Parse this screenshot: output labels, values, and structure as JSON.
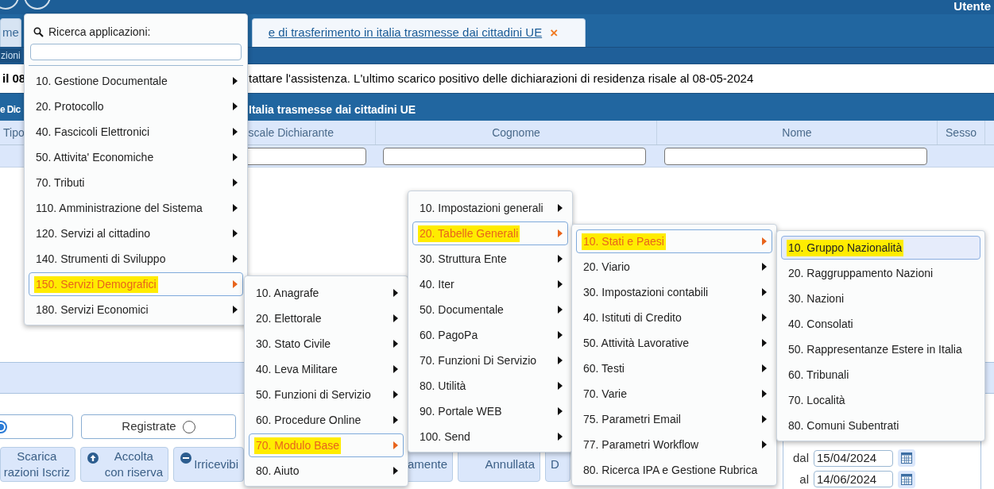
{
  "header": {
    "user": "Utente"
  },
  "tabs": [
    {
      "label": "me",
      "selected": false
    },
    {
      "label": "e di trasferimento in italia trasmesse dai cittadini UE",
      "selected": true,
      "close": "×"
    }
  ],
  "breadcrumb": "zioni",
  "message": {
    "part_1": "il 08",
    "part_2": "tattare l'assistenza. L'ultimo scarico positivo delle dichiarazioni di residenza risale al 08-05-2024"
  },
  "panel": {
    "title_part_1": "e Dic",
    "title_part_2": "Italia trasmesse dai cittadini UE"
  },
  "table": {
    "columns": [
      "Tipo",
      "scale Dichiarante",
      "Cognome",
      "Nome",
      "Sesso"
    ]
  },
  "radios": [
    {
      "selected": true
    },
    {
      "label": "Registrate",
      "selected": false
    }
  ],
  "actions": [
    {
      "label": "Scarica\nrazioni Iscriz",
      "kind": "plain"
    },
    {
      "label": "Accolta\ncon riserva",
      "kind": "accept"
    },
    {
      "label": "Irricevibi",
      "kind": "reject"
    },
    {
      "label": "amente",
      "kind": "plain"
    },
    {
      "label": "Annullata",
      "kind": "plain"
    },
    {
      "label": "D",
      "kind": "plain"
    }
  ],
  "dates": [
    {
      "label": "dal",
      "value": "15/04/2024"
    },
    {
      "label": "al",
      "value": "14/06/2024"
    }
  ],
  "search": {
    "label": "Ricerca applicazioni:"
  },
  "menus": [
    {
      "items": [
        {
          "label": "10. Gestione Documentale",
          "selected": false,
          "has_submenu": true
        },
        {
          "label": "20. Protocollo",
          "selected": false,
          "has_submenu": true
        },
        {
          "label": "40. Fascicoli Elettronici",
          "selected": false,
          "has_submenu": true
        },
        {
          "label": "50. Attivita' Economiche",
          "selected": false,
          "has_submenu": true
        },
        {
          "label": "70. Tributi",
          "selected": false,
          "has_submenu": true
        },
        {
          "label": "110. Amministrazione del Sistema",
          "selected": false,
          "has_submenu": true
        },
        {
          "label": "120. Servizi al cittadino",
          "selected": false,
          "has_submenu": true
        },
        {
          "label": "140. Strumenti di Sviluppo",
          "selected": false,
          "has_submenu": true
        },
        {
          "label": "150. Servizi Demografici",
          "selected": true,
          "has_submenu": true
        },
        {
          "label": "180. Servizi Economici",
          "selected": false,
          "has_submenu": true
        }
      ]
    },
    {
      "items": [
        {
          "label": "10. Anagrafe",
          "selected": false,
          "has_submenu": true
        },
        {
          "label": "20. Elettorale",
          "selected": false,
          "has_submenu": true
        },
        {
          "label": "30. Stato Civile",
          "selected": false,
          "has_submenu": true
        },
        {
          "label": "40. Leva Militare",
          "selected": false,
          "has_submenu": true
        },
        {
          "label": "50. Funzioni di Servizio",
          "selected": false,
          "has_submenu": true
        },
        {
          "label": "60. Procedure Online",
          "selected": false,
          "has_submenu": true
        },
        {
          "label": "70. Modulo Base",
          "selected": true,
          "has_submenu": true
        },
        {
          "label": "80. Aiuto",
          "selected": false,
          "has_submenu": true
        }
      ]
    },
    {
      "items": [
        {
          "label": "10. Impostazioni generali",
          "selected": false,
          "has_submenu": true
        },
        {
          "label": "20. Tabelle Generali",
          "selected": true,
          "has_submenu": true
        },
        {
          "label": "30. Struttura Ente",
          "selected": false,
          "has_submenu": true
        },
        {
          "label": "40. Iter",
          "selected": false,
          "has_submenu": true
        },
        {
          "label": "50. Documentale",
          "selected": false,
          "has_submenu": true
        },
        {
          "label": "60. PagoPa",
          "selected": false,
          "has_submenu": true
        },
        {
          "label": "70. Funzioni Di Servizio",
          "selected": false,
          "has_submenu": true
        },
        {
          "label": "80. Utilità",
          "selected": false,
          "has_submenu": true
        },
        {
          "label": "90. Portale WEB",
          "selected": false,
          "has_submenu": true
        },
        {
          "label": "100. Send",
          "selected": false,
          "has_submenu": true
        }
      ]
    },
    {
      "items": [
        {
          "label": "10. Stati e Paesi",
          "selected": true,
          "has_submenu": true
        },
        {
          "label": "20. Viario",
          "selected": false,
          "has_submenu": true
        },
        {
          "label": "30. Impostazioni contabili",
          "selected": false,
          "has_submenu": true
        },
        {
          "label": "40. Istituti di Credito",
          "selected": false,
          "has_submenu": true
        },
        {
          "label": "50. Attività Lavorative",
          "selected": false,
          "has_submenu": true
        },
        {
          "label": "60. Testi",
          "selected": false,
          "has_submenu": true
        },
        {
          "label": "70. Varie",
          "selected": false,
          "has_submenu": true
        },
        {
          "label": "75. Parametri Email",
          "selected": false,
          "has_submenu": true
        },
        {
          "label": "77. Parametri Workflow",
          "selected": false,
          "has_submenu": true
        },
        {
          "label": "80. Ricerca IPA e Gestione Rubrica",
          "selected": false,
          "has_submenu": false
        }
      ]
    },
    {
      "items": [
        {
          "label": "10. Gruppo Nazionalità",
          "selected": true,
          "has_submenu": false
        },
        {
          "label": "20. Raggruppamento Nazioni",
          "selected": false,
          "has_submenu": false
        },
        {
          "label": "30. Nazioni",
          "selected": false,
          "has_submenu": false
        },
        {
          "label": "40. Consolati",
          "selected": false,
          "has_submenu": false
        },
        {
          "label": "50. Rappresentanze Estere in Italia",
          "selected": false,
          "has_submenu": false
        },
        {
          "label": "60. Tribunali",
          "selected": false,
          "has_submenu": false
        },
        {
          "label": "70. Località",
          "selected": false,
          "has_submenu": false
        },
        {
          "label": "80. Comuni Subentrati",
          "selected": false,
          "has_submenu": false
        }
      ]
    }
  ]
}
